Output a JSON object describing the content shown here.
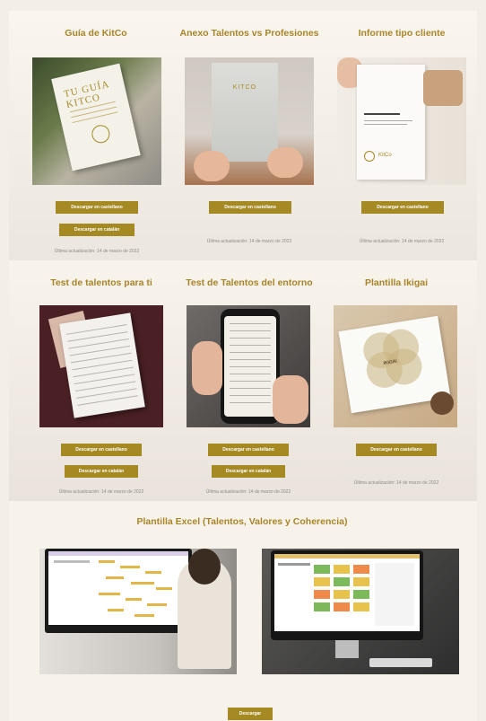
{
  "section1": {
    "items": [
      {
        "title": "Guía de KitCo",
        "buttons": [
          "Descargar en castellano",
          "Descargar en catalán"
        ],
        "updated": "Última actualización: 14 de marzo de 2022",
        "thumb_text": "TU GUÍA KITCO"
      },
      {
        "title": "Anexo Talentos vs Profesiones",
        "buttons": [
          "Descargar en castellano"
        ],
        "updated": "Última actualización: 14 de marzo de 2022",
        "thumb_text": "KITCO"
      },
      {
        "title": "Informe tipo cliente",
        "buttons": [
          "Descargar en castellano"
        ],
        "updated": "Última actualización: 14 de marzo de 2022",
        "thumb_text": "KitCo"
      }
    ]
  },
  "section2": {
    "items": [
      {
        "title": "Test de talentos para ti",
        "buttons": [
          "Descargar en castellano",
          "Descargar en catalán"
        ],
        "updated": "Última actualización: 14 de marzo de 2022"
      },
      {
        "title": "Test de Talentos del entorno",
        "buttons": [
          "Descargar en castellano",
          "Descargar en catalán"
        ],
        "updated": "Última actualización: 14 de marzo de 2022"
      },
      {
        "title": "Plantilla Ikigai",
        "buttons": [
          "Descargar en castellano"
        ],
        "updated": "Última actualización: 14 de marzo de 2022",
        "thumb_text": "IKIGAI"
      }
    ]
  },
  "section3": {
    "title": "Plantilla Excel (Talentos, Valores y Coherencia)",
    "button": "Descargar"
  },
  "colors": {
    "accent": "#a58a24",
    "title": "#a8852a",
    "background": "#f3eee6"
  }
}
